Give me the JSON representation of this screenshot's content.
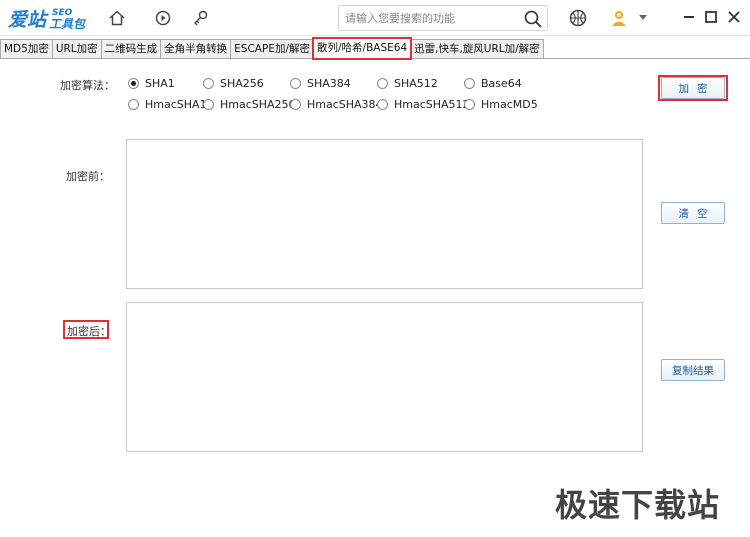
{
  "app": {
    "logo_text": "爱站",
    "logo_sub": "SEO",
    "logo_sub2": "工具包"
  },
  "toolbar": {
    "search_placeholder": "请输入您要搜索的功能",
    "icons": [
      "home-icon",
      "play-icon",
      "settings-icon",
      "basketball-icon",
      "user-icon",
      "dropdown-arrow-icon",
      "minimize-icon",
      "maximize-icon",
      "close-icon"
    ]
  },
  "tabs": [
    {
      "label": "MD5加密",
      "active": false
    },
    {
      "label": "URL加密",
      "active": false
    },
    {
      "label": "二维码生成",
      "active": false
    },
    {
      "label": "全角半角转换",
      "active": false
    },
    {
      "label": "ESCAPE加/解密",
      "active": false
    },
    {
      "label": "散列/哈希/BASE64",
      "active": true
    },
    {
      "label": "迅雷,快车,旋风URL加/解密",
      "active": false
    }
  ],
  "form": {
    "algorithm_label": "加密算法：",
    "algorithms_row1": [
      "SHA1",
      "SHA256",
      "SHA384",
      "SHA512",
      "Base64"
    ],
    "algorithms_row2": [
      "HmacSHA1",
      "HmacSHA256",
      "HmacSHA384",
      "HmacSHA512",
      "HmacMD5"
    ],
    "selected": "SHA1",
    "before_label": "加密前：",
    "after_label": "加密后：",
    "before_value": "",
    "after_value": ""
  },
  "buttons": {
    "encrypt": "加密",
    "clear": "清空",
    "copy": "复制结果"
  },
  "watermark": "极速下载站",
  "colors": {
    "highlight_red": "#e03030",
    "button_text": "#1e5a99",
    "logo_blue": "#1d7fd6"
  }
}
